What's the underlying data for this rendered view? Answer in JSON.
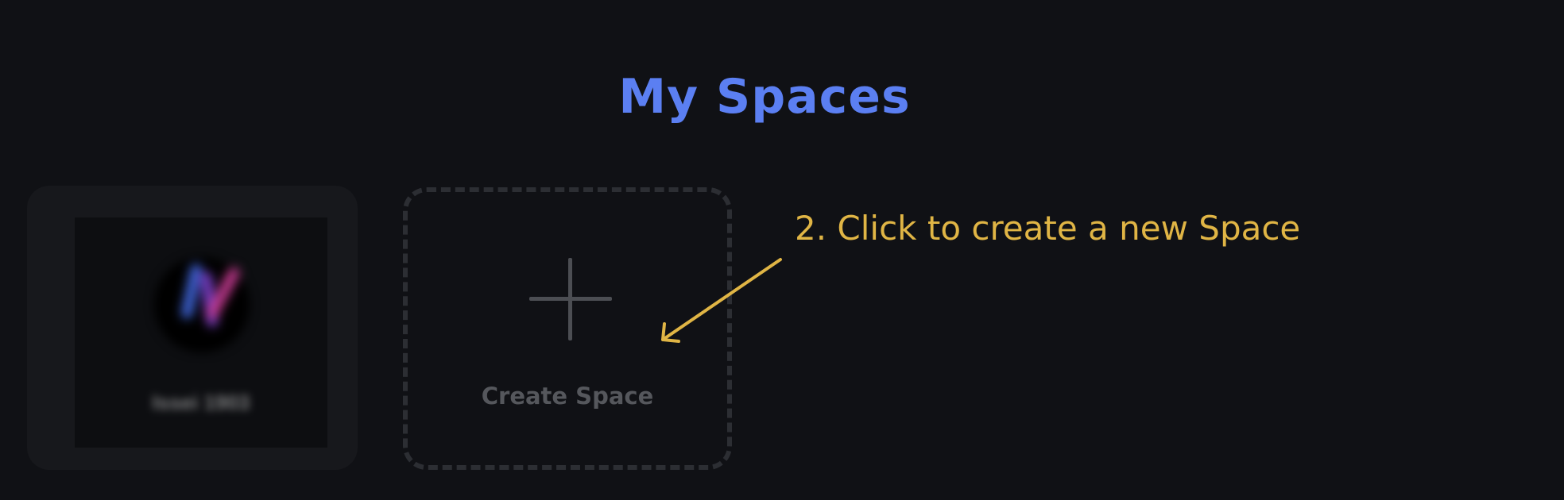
{
  "header": {
    "title": "My Spaces"
  },
  "spaces": [
    {
      "name": "Issei 1903"
    }
  ],
  "create_space": {
    "label": "Create Space",
    "icon": "plus-icon"
  },
  "annotation": {
    "text": "2. Click to create a new Space",
    "icon": "arrow-icon"
  },
  "colors": {
    "background": "#101115",
    "title": "#5b7ff2",
    "annotation": "#e0b545",
    "card": "#17181c",
    "dashed_border": "#2c2e33",
    "muted_text": "#55575c"
  }
}
